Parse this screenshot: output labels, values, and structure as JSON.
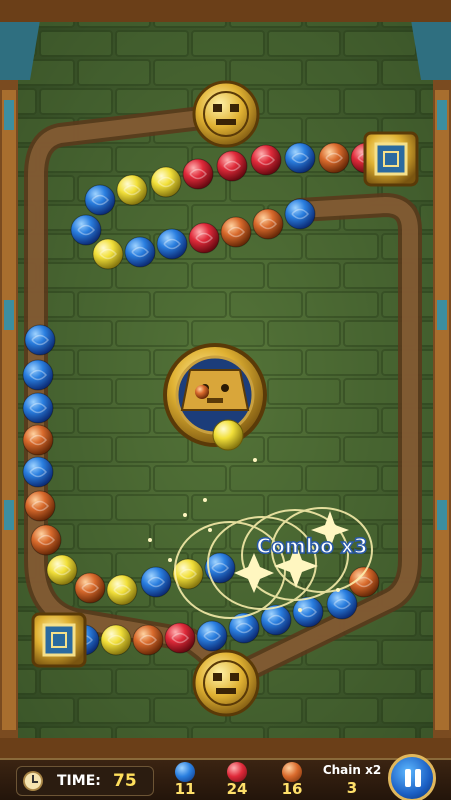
{
  "hud": {
    "time_label": "TIME:",
    "time_value": "75",
    "counts": [
      {
        "color": "#2a7fe0",
        "icon": "blue-ball-icon",
        "value": "11"
      },
      {
        "color": "#e02a3a",
        "icon": "red-ball-icon",
        "value": "24"
      },
      {
        "color": "#d76a2a",
        "icon": "orange-ball-icon",
        "value": "16"
      }
    ],
    "chain_label": "Chain x2",
    "chain_value": "3",
    "pause_icon": "pause-icon"
  },
  "combo_text": "Combo x3",
  "shooter_next_ball": "yellow",
  "colors": {
    "blue": "#2a7fe0",
    "red": "#e02a3a",
    "yellow": "#f2e03a",
    "orange": "#d96a2c",
    "wall": "#3e5a2c",
    "frame": "#7a4b20"
  }
}
